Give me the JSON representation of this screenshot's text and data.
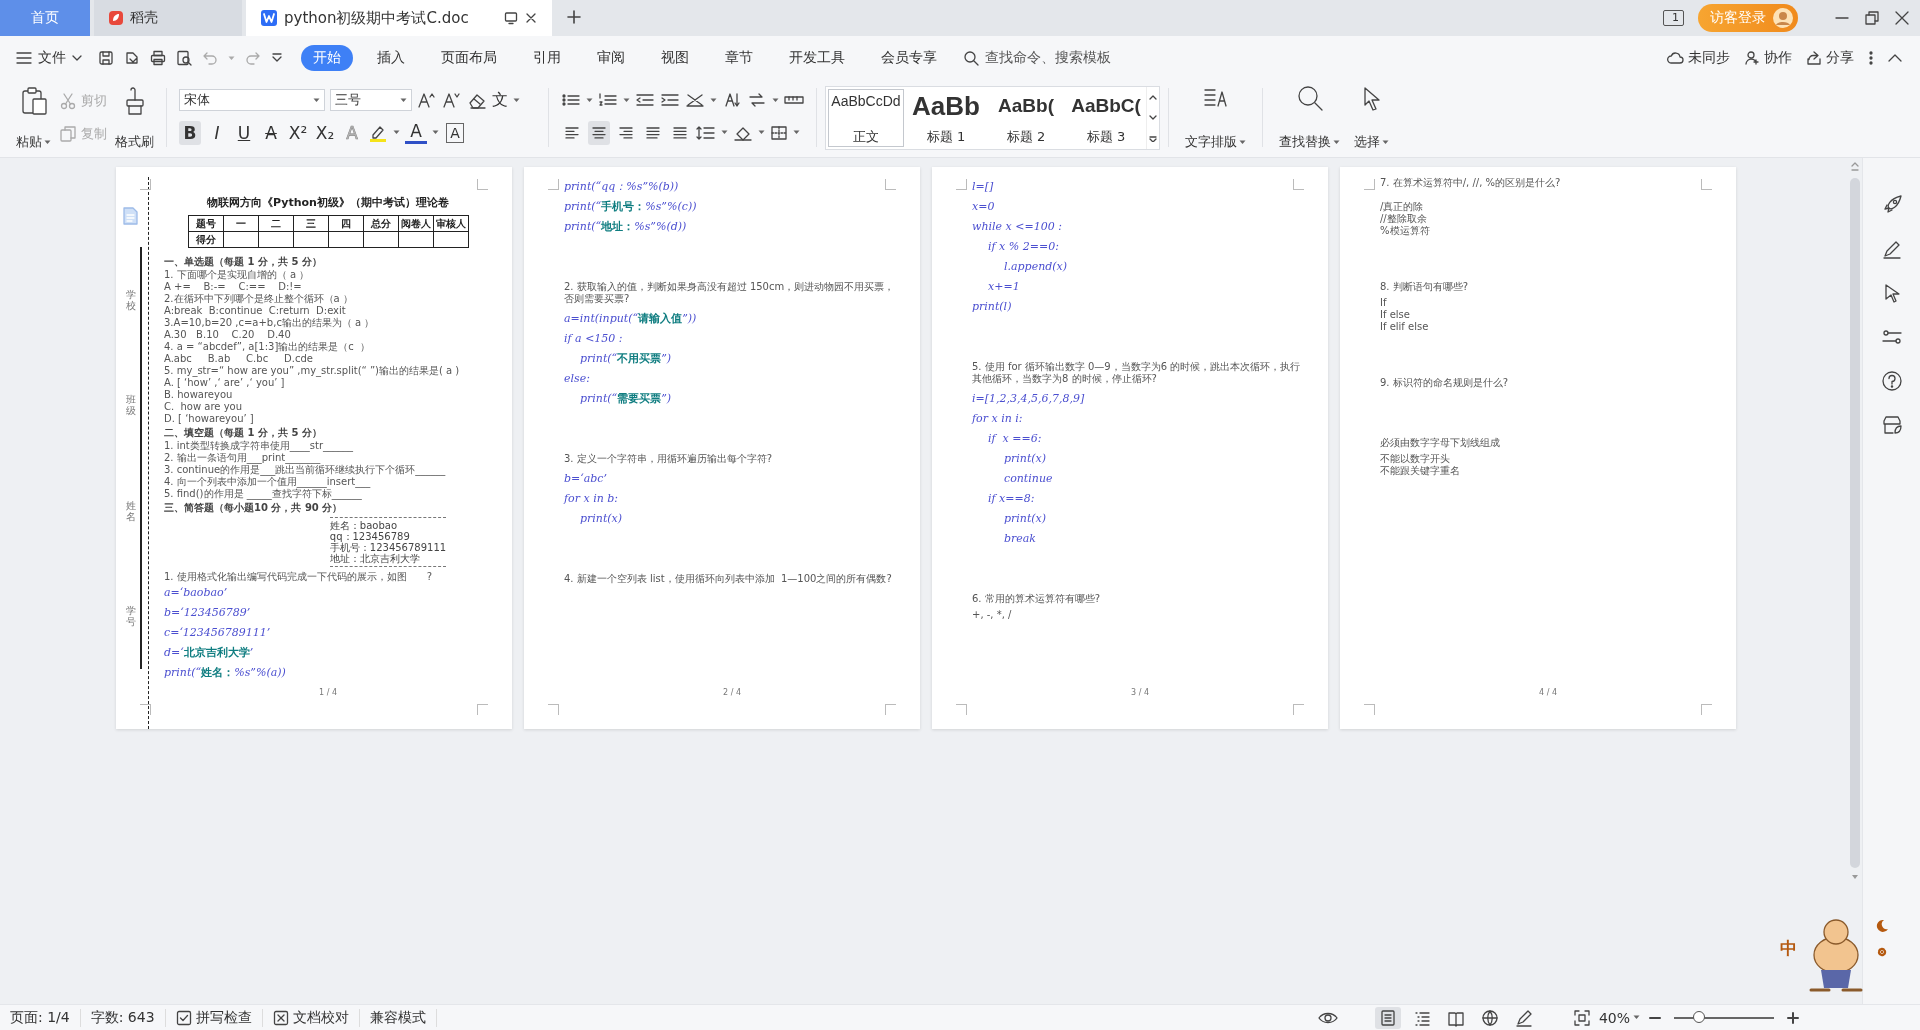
{
  "tabs": [
    {
      "label": "首页",
      "kind": "home",
      "selected": false
    },
    {
      "label": "稻壳",
      "kind": "store",
      "selected": false
    },
    {
      "label": "python初级期中考试C.doc",
      "kind": "doc",
      "selected": true
    }
  ],
  "account": {
    "window_count": "1",
    "login": "访客登录"
  },
  "menu": {
    "file": "文件",
    "tabs": [
      {
        "label": "开始",
        "selected": true
      },
      {
        "label": "插入",
        "selected": false
      },
      {
        "label": "页面布局",
        "selected": false
      },
      {
        "label": "引用",
        "selected": false
      },
      {
        "label": "审阅",
        "selected": false
      },
      {
        "label": "视图",
        "selected": false
      },
      {
        "label": "章节",
        "selected": false
      },
      {
        "label": "开发工具",
        "selected": false
      },
      {
        "label": "会员专享",
        "selected": false
      }
    ],
    "search": {
      "placeholder": "查找命令、搜索模板"
    },
    "actions": [
      {
        "label": "未同步",
        "kind": "sync"
      },
      {
        "label": "协作",
        "kind": "share-people"
      },
      {
        "label": "分享",
        "kind": "share"
      }
    ]
  },
  "ribbon": {
    "paste": "粘贴",
    "cut": {
      "label": "剪切",
      "disabled": true
    },
    "copy": {
      "label": "复制",
      "disabled": true
    },
    "format_painter": "格式刷",
    "font": "宋体",
    "size": "三号",
    "phonetic": "文",
    "format": [
      {
        "glyph": "B",
        "kind": "bold",
        "on": true
      },
      {
        "glyph": "I",
        "kind": "italic",
        "on": false
      },
      {
        "glyph": "U",
        "kind": "underline",
        "on": false
      },
      {
        "glyph": "A",
        "kind": "strike",
        "on": false
      },
      {
        "glyph": "X²",
        "kind": "script",
        "on": false
      },
      {
        "glyph": "X₂",
        "kind": "script",
        "on": false
      },
      {
        "glyph": "A",
        "kind": "effect",
        "on": false
      }
    ],
    "font_color": "A",
    "char_border": "A",
    "alignments": [
      {
        "kind": "left",
        "selected": false
      },
      {
        "kind": "center",
        "selected": true
      },
      {
        "kind": "right",
        "selected": false
      },
      {
        "kind": "justify",
        "selected": false
      },
      {
        "kind": "distributed",
        "selected": false
      }
    ],
    "styles": [
      {
        "sample": "AaBbCcDd",
        "label": "正文",
        "selected": true
      },
      {
        "sample": "AaBb",
        "label": "标题 1",
        "selected": false
      },
      {
        "sample": "AaBb(",
        "label": "标题 2",
        "selected": false
      },
      {
        "sample": "AaBbC(",
        "label": "标题 3",
        "selected": false
      }
    ],
    "text_layout": "文字排版",
    "find_replace": "查找替换",
    "select": "选择"
  },
  "pages": [
    {
      "binding": [
        "学校",
        "班级",
        "姓名",
        "学号"
      ],
      "page_number": "1 / 4",
      "lines": [
        {
          "kind": "title",
          "text": "物联网方向《Python初级》（期中考试）理论卷"
        },
        {
          "kind": "score_table",
          "header": [
            "题号",
            "一",
            "二",
            "三",
            "四",
            "总分",
            "阅卷人",
            "审核人"
          ],
          "row_label": "得分"
        },
        {
          "kind": "section",
          "text": "一、单选题（每题 1 分，共 5 分）"
        },
        {
          "kind": "text",
          "text": "1. 下面哪个是实现自增的（ a ）"
        },
        {
          "kind": "text",
          "text": "A +=    B:-=    C:==    D:!="
        },
        {
          "kind": "text",
          "text": "2.在循环中下列哪个是终止整个循环（a ）"
        },
        {
          "kind": "text",
          "text": "A:break  B:continue  C:return  D:exit"
        },
        {
          "kind": "text",
          "text": "3.A=10,b=20 ,c=a+b,c输出的结果为（ a ）"
        },
        {
          "kind": "text",
          "text": "A.30   B.10    C.20    D.40"
        },
        {
          "kind": "text",
          "text": "4. a = “abcdef”, a[1:3]输出的结果是（c  ）"
        },
        {
          "kind": "text",
          "text": "A.abc     B.ab     C.bc     D.cde"
        },
        {
          "kind": "text",
          "text": "5. my_str=“ how are you” ,my_str.split(“ ”)输出的结果是( a )"
        },
        {
          "kind": "text",
          "text": "A. [ ‘how’ ,‘ are’ ,‘ you’ ]"
        },
        {
          "kind": "text",
          "text": "B. howareyou"
        },
        {
          "kind": "text",
          "text": "C.  how are you"
        },
        {
          "kind": "text",
          "text": "D. [ ‘howareyou’ ]"
        },
        {
          "kind": "section",
          "text": "二、填空题（每题 1 分，共 5 分）"
        },
        {
          "kind": "text",
          "text": "1. int类型转换成字符串使用____str______"
        },
        {
          "kind": "text",
          "text": "2. 输出一条语句用___print_______"
        },
        {
          "kind": "text",
          "text": "3. continue的作用是___跳出当前循环继续执行下个循环______"
        },
        {
          "kind": "text",
          "text": "4. 向一个列表中添加一个值用______insert___"
        },
        {
          "kind": "text",
          "text": "5. find()的作用是 _____查找字符下标______"
        },
        {
          "kind": "section",
          "text": "三、简答题（每小题10 分，共 90 分）"
        },
        {
          "kind": "info_card",
          "lines": [
            "姓名：baobao",
            "qq：123456789",
            "手机号：123456789111",
            "地址：北京吉利大学"
          ]
        },
        {
          "kind": "text",
          "text": "1. 使用格式化输出编写代码完成一下代码的展示，如图",
          "aside": "?"
        },
        {
          "kind": "code",
          "text": "a=‘baobao’"
        },
        {
          "kind": "code",
          "text": "b=‘123456789’"
        },
        {
          "kind": "code",
          "text": "c=‘123456789111’"
        },
        {
          "kind": "code",
          "text": "d=‘**北京吉利大学**’"
        },
        {
          "kind": "code",
          "text": "print(“**姓名：**%s”%(a))"
        }
      ]
    },
    {
      "page_number": "2 / 4",
      "lines": [
        {
          "kind": "code",
          "text": "print(“qq：%s”%(b))"
        },
        {
          "kind": "code",
          "text": "print(“**手机号：**%s”%(c))"
        },
        {
          "kind": "code",
          "text": "print(“**地址：**%s”%(d))"
        },
        {
          "kind": "question",
          "text": "2. 获取输入的值，判断如果身高没有超过 150cm，则进动物园不用买票，否则需要买票?"
        },
        {
          "kind": "code",
          "text": "a=int(input(“**请输入值**”))"
        },
        {
          "kind": "code",
          "text": "if a <150 :",
          "children": [
            {
              "kind": "code",
              "text": "print(“**不用买票**”)"
            }
          ]
        },
        {
          "kind": "code",
          "text": "else:",
          "children": [
            {
              "kind": "code",
              "text": "print(“**需要买票**”)"
            }
          ]
        },
        {
          "kind": "question",
          "text": "3. 定义一个字符串，用循环遍历输出每个字符?"
        },
        {
          "kind": "code",
          "text": "b=‘abc’"
        },
        {
          "kind": "code",
          "text": "for x in b:",
          "children": [
            {
              "kind": "code",
              "text": "print(x)"
            }
          ]
        },
        {
          "kind": "question",
          "text": "4. 新建一个空列表 list，使用循环向列表中添加  1—100之间的所有偶数?"
        }
      ]
    },
    {
      "page_number": "3 / 4",
      "lines": [
        {
          "kind": "code",
          "text": "l=[]"
        },
        {
          "kind": "code",
          "text": "x=0"
        },
        {
          "kind": "code",
          "text": "while x <=100 :",
          "children": [
            {
              "kind": "code",
              "text": "if x % 2==0:",
              "children": [
                {
                  "kind": "code",
                  "text": "l.append(x)"
                }
              ]
            },
            {
              "kind": "code",
              "text": "x+=1"
            }
          ]
        },
        {
          "kind": "code",
          "text": "print(l)"
        },
        {
          "kind": "question",
          "text": "5. 使用 for 循环输出数字 0—9，当数字为6 的时候，跳出本次循环，执行其他循环，当数字为8 的时候，停止循环?"
        },
        {
          "kind": "code",
          "text": "i=[1,2,3,4,5,6,7,8,9]"
        },
        {
          "kind": "code",
          "text": "for x in i:",
          "children": [
            {
              "kind": "code",
              "text": "if  x ==6:",
              "children": [
                {
                  "kind": "code",
                  "text": "print(x)"
                },
                {
                  "kind": "code",
                  "text": "continue"
                }
              ]
            },
            {
              "kind": "code",
              "text": "if x==8:",
              "children": [
                {
                  "kind": "code",
                  "text": "print(x)"
                },
                {
                  "kind": "code",
                  "text": "break"
                }
              ]
            }
          ]
        },
        {
          "kind": "question",
          "text": "6. 常用的算术运算符有哪些?"
        },
        {
          "kind": "text",
          "text": "+, -, *, /"
        }
      ]
    },
    {
      "page_number": "4 / 4",
      "lines": [
        {
          "kind": "text",
          "text": "7. 在算术运算符中/, //, %的区别是什么?"
        },
        {
          "kind": "answer",
          "text": "/真正的除"
        },
        {
          "kind": "text",
          "text": "//整除取余"
        },
        {
          "kind": "text",
          "text": "%模运算符"
        },
        {
          "kind": "question",
          "text": "8. 判断语句有哪些?"
        },
        {
          "kind": "text",
          "text": "If"
        },
        {
          "kind": "text",
          "text": "If else"
        },
        {
          "kind": "text",
          "text": "If elif else"
        },
        {
          "kind": "question",
          "text": "9. 标识符的命名规则是什么?"
        },
        {
          "kind": "question",
          "text": "必须由数字字母下划线组成"
        },
        {
          "kind": "text",
          "text": "不能以数字开头"
        },
        {
          "kind": "text",
          "text": "不能跟关键字重名"
        }
      ]
    }
  ],
  "ime": {
    "mode": "中"
  },
  "status_bar": {
    "items": [
      "页面: 1/4",
      "字数: 643"
    ],
    "checks": [
      "拼写检查",
      "文档校对"
    ],
    "mode": "兼容模式",
    "views": [
      {
        "kind": "page",
        "selected": true
      },
      {
        "kind": "outline",
        "selected": false
      },
      {
        "kind": "reading",
        "selected": false
      },
      {
        "kind": "web",
        "selected": false
      },
      {
        "kind": "write",
        "selected": false
      }
    ],
    "zoom": "40%",
    "zoom_slider": {
      "level": 0.25
    }
  }
}
